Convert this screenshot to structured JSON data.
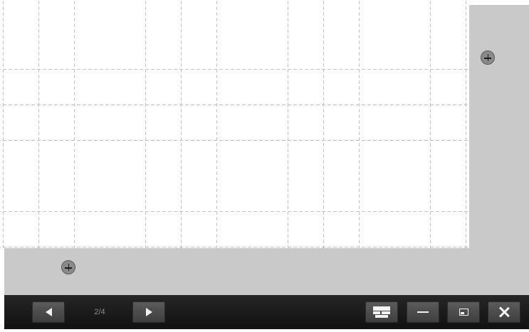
{
  "navigation": {
    "page_indicator": "2/4"
  },
  "icons": {
    "prev": "triangle-left-icon",
    "next": "triangle-right-icon",
    "fit": "fit-screen-icon",
    "minimize": "minimize-icon",
    "restore": "restore-window-icon",
    "close": "close-icon",
    "handle": "plus-circle-icon"
  },
  "colors": {
    "toolbar": "#1a1a1a",
    "button": "#4d4d4d",
    "margin": "#c9c9c9",
    "grid_line": "#c2c2c2"
  }
}
